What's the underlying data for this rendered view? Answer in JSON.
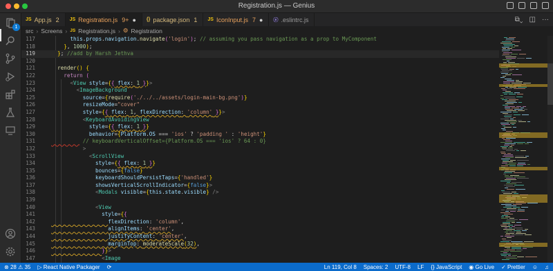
{
  "window": {
    "title": "Registration.js — Genius"
  },
  "tabs": [
    {
      "icon": "JS",
      "label": "App.js",
      "badge": "2",
      "active": false,
      "modified": false
    },
    {
      "icon": "JS",
      "label": "Registration.js",
      "badge": "9+",
      "active": true,
      "modified": true
    },
    {
      "icon": "{}",
      "label": "package.json",
      "badge": "1",
      "active": false,
      "modified": false
    },
    {
      "icon": "JS",
      "label": "IconInput.js",
      "badge": "7",
      "active": false,
      "modified": true
    },
    {
      "icon": "ⓔ",
      "label": ".eslintrc.js",
      "badge": "",
      "active": false,
      "modified": false
    }
  ],
  "breadcrumb": [
    "src",
    "Screens",
    "Registration.js",
    "Registration"
  ],
  "activity": {
    "source_control_badge": "1"
  },
  "editor": {
    "line_numbers": [
      "117",
      "118",
      "119",
      "120",
      "121",
      "122",
      "123",
      "124",
      "125",
      "126",
      "127",
      "128",
      "129",
      "130",
      "131",
      "132",
      "133",
      "134",
      "135",
      "136",
      "137",
      "138",
      "139",
      "140",
      "141",
      "142",
      "143",
      "144",
      "145",
      "146",
      "147"
    ],
    "current_line": "119"
  },
  "status": {
    "errors": "28",
    "warnings": "35",
    "packager": "React Native Packager",
    "position": "Ln 119, Col 8",
    "spaces": "Spaces: 2",
    "encoding": "UTF-8",
    "eol": "LF",
    "language": "JavaScript",
    "golive": "Go Live",
    "prettier": "Prettier"
  },
  "colors": {
    "statusbar": "#0b6bcb",
    "accent": "#0e7ad3",
    "background": "#1e1e1e"
  }
}
